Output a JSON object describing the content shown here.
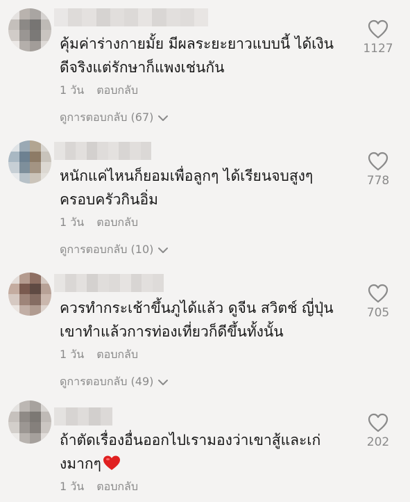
{
  "comments": [
    {
      "text": "คุ้มค่าร่างกายมั้ย มีผลระยะยาวแบบนี้ ได้เงิน\nดีจริงแต่รักษาก็แพงเช่นกัน",
      "time": "1 วัน",
      "reply_label": "ตอบกลับ",
      "view_replies": "ดูการตอบกลับ (67)",
      "likes": "1127",
      "avatar_colors": [
        "#e5e2e0",
        "#b9b3ae",
        "#a9a5a2",
        "#d6d3d1",
        "#c4bfbb",
        "#8c8986",
        "#777573",
        "#bebab6",
        "#d1ccc8",
        "#9a9693",
        "#7b7977",
        "#c9c4c0",
        "#ece9e7",
        "#b4afab",
        "#a29d99",
        "#dedad7"
      ],
      "username_colors": [
        "#e9e7e6",
        "#dedbd9",
        "#e4e1df",
        "#d6d3d1",
        "#e1dedc",
        "#dcd9d7",
        "#e7e4e2",
        "#d9d6d4",
        "#e2dfdd",
        "#dfdcda",
        "#e8e5e3"
      ]
    },
    {
      "text": "หนักแค่ไหนก็ยอมเพื่อลูกๆ ได้เรียนจบสูงๆ\nครอบครัวกินอิ่ม",
      "time": "1 วัน",
      "reply_label": "ตอบกลับ",
      "view_replies": "ดูการตอบกลับ (10)",
      "likes": "778",
      "avatar_colors": [
        "#dfe3e6",
        "#9aa9b4",
        "#b2a591",
        "#d8d5d0",
        "#a9b8c3",
        "#6d8191",
        "#8d7b66",
        "#c8c3bb",
        "#c7cfd5",
        "#7e8f9b",
        "#a39483",
        "#dcd8d2",
        "#e8eaec",
        "#b7c1c8",
        "#cbc4ba",
        "#e4e1dc"
      ],
      "username_colors": [
        "#e6e4e2",
        "#d9d6d4",
        "#e2dfdd",
        "#d3d0ce",
        "#dfdcda",
        "#e4e1df",
        "#d8d5d3",
        "#e1dedc",
        "#dbd8d6"
      ]
    },
    {
      "text": "ควรทำกระเช้าขึ้นภูได้แล้ว ดูจีน สวิตช์ ญี่ปุ่น\nเขาทำแล้วการท่องเที่ยวก็ดีขึ้นทั้งนั้น",
      "time": "1 วัน",
      "reply_label": "ตอบกลับ",
      "view_replies": "ดูการตอบกลับ (49)",
      "likes": "705",
      "avatar_colors": [
        "#e3dcd8",
        "#b49b8f",
        "#8e6f63",
        "#d4c8c1",
        "#c4aca0",
        "#7a5a4f",
        "#5f4a43",
        "#b7a196",
        "#d6c9c2",
        "#9e8479",
        "#856c62",
        "#cab7ad",
        "#ebe5e1",
        "#c1aea5",
        "#b09b90",
        "#ded4ce"
      ],
      "username_colors": [
        "#e7e5e3",
        "#dad7d5",
        "#e3e0de",
        "#d4d1cf",
        "#e0dddb",
        "#dddad8",
        "#e6e3e1",
        "#d8d5d3",
        "#e2dfdd",
        "#dedbd9"
      ]
    },
    {
      "text": "ถ้าตัดเรื่องอื่นออกไปเรามองว่าเขาสู้และเก่\nงมากๆ",
      "time": "1 วัน",
      "reply_label": "ตอบกลับ",
      "view_replies": "",
      "likes": "202",
      "avatar_colors": [
        "#e4e2e0",
        "#bcb7b3",
        "#a7a29e",
        "#d9d6d3",
        "#c6c1bd",
        "#8f8a86",
        "#7c7874",
        "#bfbab6",
        "#d3cfcb",
        "#9c9793",
        "#85807c",
        "#cbc6c2",
        "#eceae8",
        "#b8b3af",
        "#a5a09c",
        "#e0dcd9"
      ],
      "username_colors": [
        "#e4e2e0",
        "#d7d4d2",
        "#dfdcda",
        "#d2cfcd",
        "#dcd9d7"
      ]
    }
  ],
  "colors": {
    "background": "#f4f3f2",
    "text": "#161616",
    "muted": "#8a8a8a",
    "heart_outline": "#8a8a8a",
    "emoji_heart": "#e02020"
  },
  "icons": {
    "like": "heart-outline-icon",
    "expand": "chevron-down-icon",
    "emoji": "red-heart-emoji"
  }
}
